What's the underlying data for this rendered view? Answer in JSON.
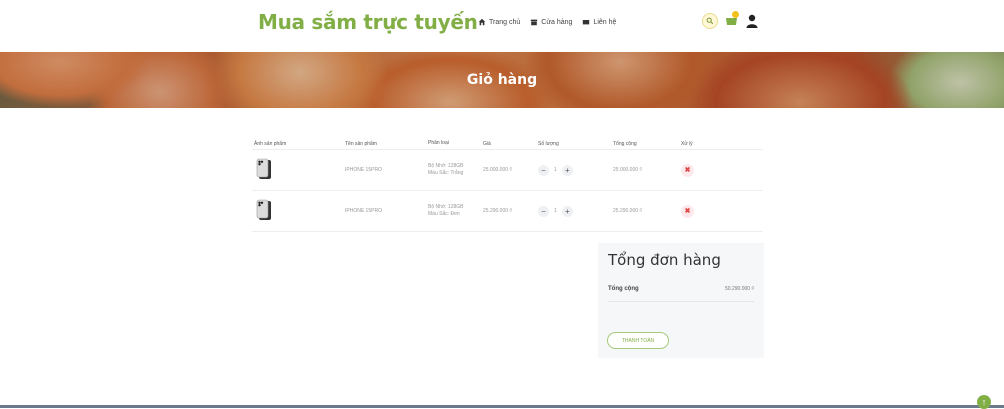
{
  "header": {
    "brand": "Mua sắm trực tuyến",
    "nav": [
      {
        "label": "Trang chủ",
        "icon": "home-icon"
      },
      {
        "label": "Cửa hàng",
        "icon": "store-icon"
      },
      {
        "label": "Liên hệ",
        "icon": "mail-icon"
      }
    ],
    "icons": [
      "search-icon",
      "cart-icon",
      "user-icon"
    ]
  },
  "hero": {
    "title": "Giỏ hàng"
  },
  "cart": {
    "columns": [
      "Ảnh sản phẩm",
      "Tên sản phẩm",
      "Phân loại",
      "Giá",
      "Số lượng",
      "Tổng cộng",
      "Xử lý"
    ],
    "items": [
      {
        "name": "IPHONE 15PRO",
        "storage": "Bộ Nhớ: 128GB",
        "color": "Màu Sắc: Trắng",
        "price": "25.000.000 ₫",
        "qty": "1",
        "total": "25.000.000 ₫"
      },
      {
        "name": "IPHONE 15PRO",
        "storage": "Bộ Nhớ: 128GB",
        "color": "Màu Sắc: Đen",
        "price": "25.290.000 ₫",
        "qty": "1",
        "total": "25.290.000 ₫"
      }
    ]
  },
  "summary": {
    "title": "Tổng đơn hàng",
    "total_label": "Tổng cộng",
    "total_value": "50.290.000 ₫",
    "checkout_label": "THANH TOÁN"
  },
  "colors": {
    "brand": "#82ae46",
    "delete": "#e04848",
    "summary_bg": "#f6f7f9"
  },
  "back_to_top": "↑"
}
